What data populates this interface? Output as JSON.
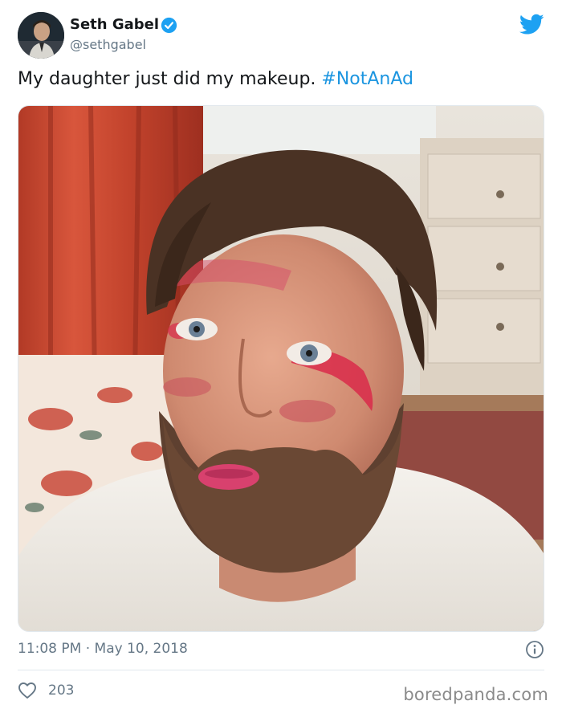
{
  "tweet": {
    "author_name": "Seth Gabel",
    "handle": "@sethgabel",
    "text": "My daughter just did my makeup. ",
    "hashtag": "#NotAnAd",
    "timestamp": "11:08 PM · May 10, 2018",
    "likes": "203"
  },
  "icons": {
    "verified": "verified-badge-icon",
    "platform": "twitter-bird-icon",
    "info": "info-icon",
    "like": "heart-icon"
  },
  "colors": {
    "brand_blue": "#1da1f2",
    "hashtag": "#1b95e0",
    "secondary_text": "#657786",
    "primary_text": "#14171a"
  },
  "watermark": "boredpanda.com"
}
